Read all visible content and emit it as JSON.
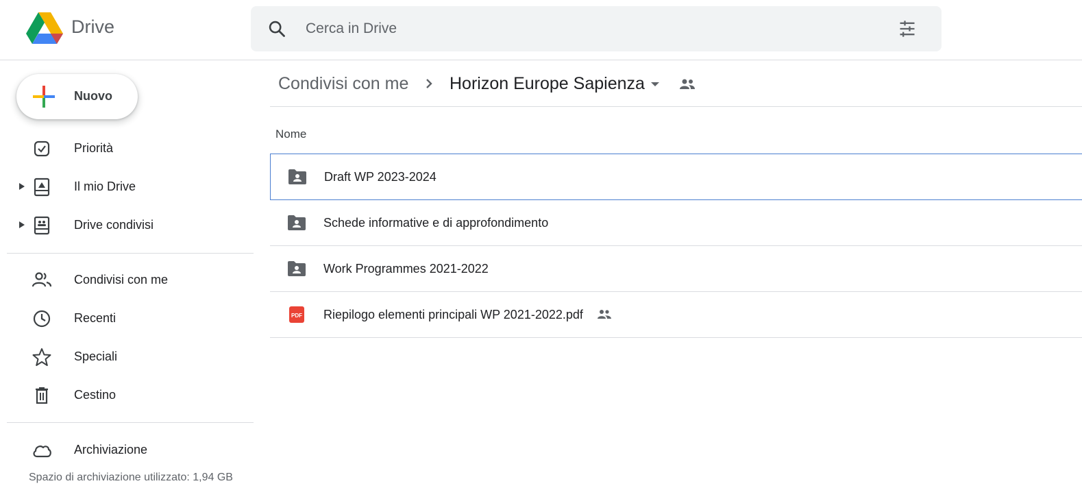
{
  "app": {
    "title": "Drive",
    "brand_colors": {
      "green": "#0f9d58",
      "blue": "#4285f4",
      "yellow": "#f4b400",
      "red": "#db4437"
    }
  },
  "search": {
    "placeholder": "Cerca in Drive",
    "value": ""
  },
  "sidebar": {
    "new_label": "Nuovo",
    "items": [
      {
        "label": "Priorità",
        "icon": "check-box-icon"
      },
      {
        "label": "Il mio Drive",
        "icon": "my-drive-icon",
        "expandable": true
      },
      {
        "label": "Drive condivisi",
        "icon": "shared-drives-icon",
        "expandable": true
      },
      {
        "label": "Condivisi con me",
        "icon": "people-icon"
      },
      {
        "label": "Recenti",
        "icon": "clock-icon"
      },
      {
        "label": "Speciali",
        "icon": "star-icon"
      },
      {
        "label": "Cestino",
        "icon": "trash-icon"
      },
      {
        "label": "Archiviazione",
        "icon": "cloud-icon"
      }
    ],
    "storage_text": "Spazio di archiviazione utilizzato: 1,94 GB"
  },
  "breadcrumb": {
    "root": "Condivisi con me",
    "current": "Horizon Europe Sapienza"
  },
  "list": {
    "column_name": "Nome",
    "files": [
      {
        "name": "Draft WP 2023-2024",
        "type": "shared-folder",
        "selected": true
      },
      {
        "name": "Schede informative e di approfondimento",
        "type": "shared-folder"
      },
      {
        "name": "Work Programmes 2021-2022",
        "type": "shared-folder"
      },
      {
        "name": "Riepilogo elementi principali WP 2021-2022.pdf",
        "type": "pdf",
        "shared": true,
        "pdf_badge": "PDF"
      }
    ]
  }
}
